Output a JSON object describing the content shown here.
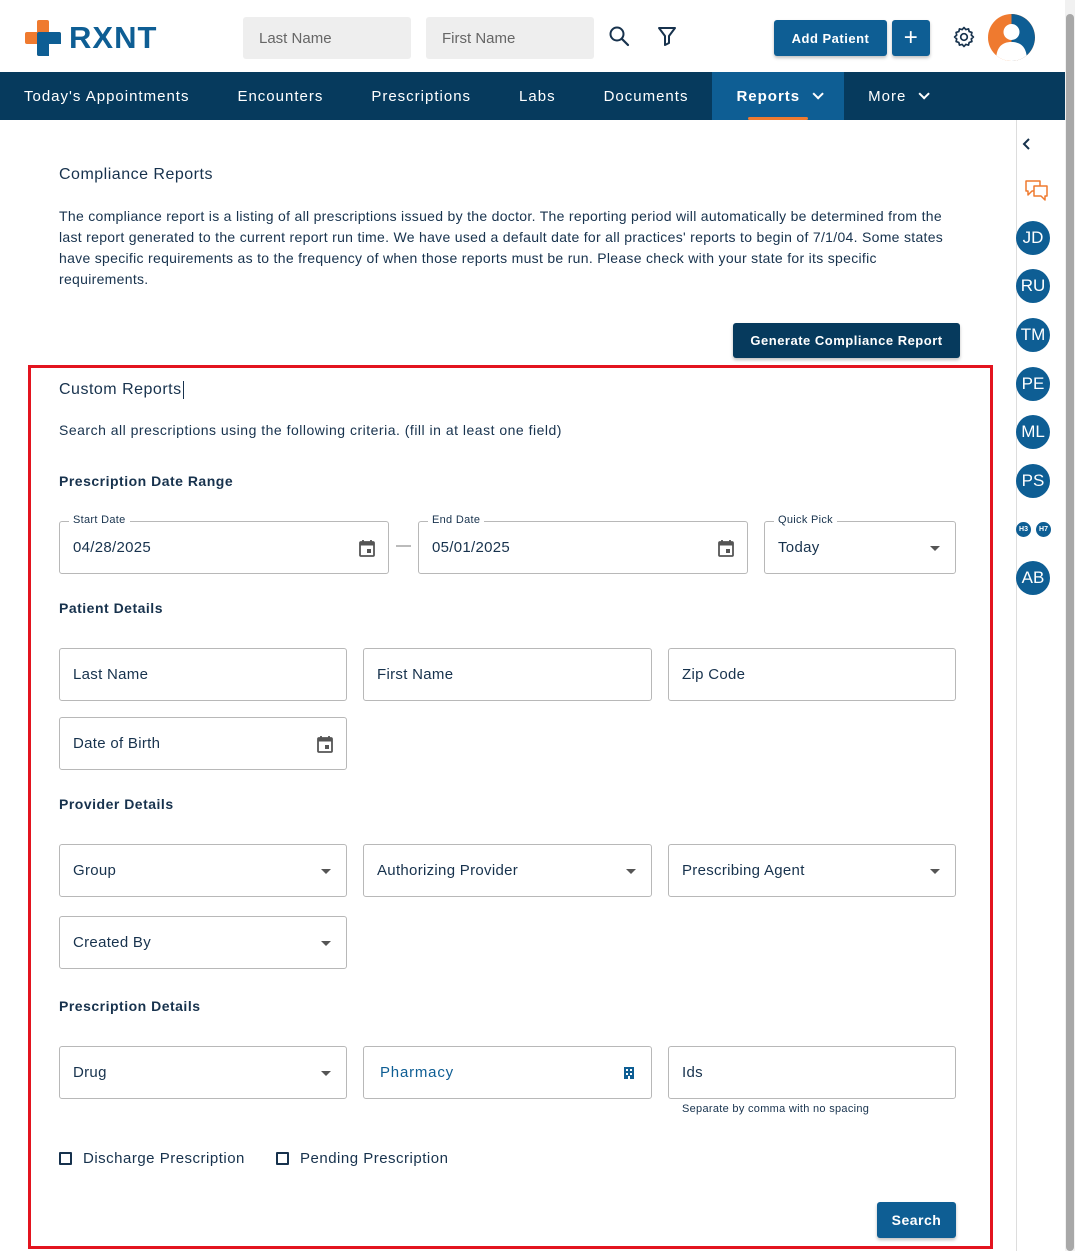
{
  "brand": {
    "name": "RXNT"
  },
  "header": {
    "last_name_placeholder": "Last Name",
    "first_name_placeholder": "First Name",
    "add_patient_label": "Add Patient",
    "plus_label": "+"
  },
  "nav": {
    "items": [
      "Today's Appointments",
      "Encounters",
      "Prescriptions",
      "Labs",
      "Documents",
      "Reports",
      "More"
    ],
    "active": "Reports"
  },
  "rail": {
    "avatars": [
      "JD",
      "RU",
      "TM",
      "PE",
      "ML",
      "PS"
    ],
    "mini": [
      "H3",
      "H7"
    ],
    "last": "AB"
  },
  "compliance": {
    "title": "Compliance Reports",
    "description": "The compliance report is a listing of all prescriptions issued by the doctor. The reporting period will automatically be determined from the last report generated to the current report run time. We have used a default date for all practices' reports to begin of 7/1/04. Some states have specific requirements as to the frequency of when those reports must be run. Please check with your state for its specific requirements.",
    "generate_button": "Generate Compliance Report"
  },
  "custom": {
    "title": "Custom Reports",
    "instructions": "Search all prescriptions using the following criteria. (fill in at least one field)",
    "date_section": "Prescription Date Range",
    "start_label": "Start Date",
    "start_value": "04/28/2025",
    "range_sep": "—",
    "end_label": "End Date",
    "end_value": "05/01/2025",
    "quick_label": "Quick Pick",
    "quick_value": "Today",
    "patient_section": "Patient Details",
    "last_name": "Last Name",
    "first_name": "First Name",
    "zip": "Zip Code",
    "dob": "Date of Birth",
    "provider_section": "Provider Details",
    "group": "Group",
    "authorizing": "Authorizing Provider",
    "prescribing": "Prescribing Agent",
    "created_by": "Created By",
    "rx_section": "Prescription Details",
    "drug": "Drug",
    "pharmacy": "Pharmacy",
    "ids": "Ids",
    "ids_hint": "Separate by comma with no spacing",
    "discharge": "Discharge Prescription",
    "pending": "Pending Prescription",
    "search_button": "Search"
  },
  "colors": {
    "primary": "#0e5e94",
    "nav": "#063a5d",
    "accent": "#ef7a2f",
    "highlight": "#e3141f"
  }
}
